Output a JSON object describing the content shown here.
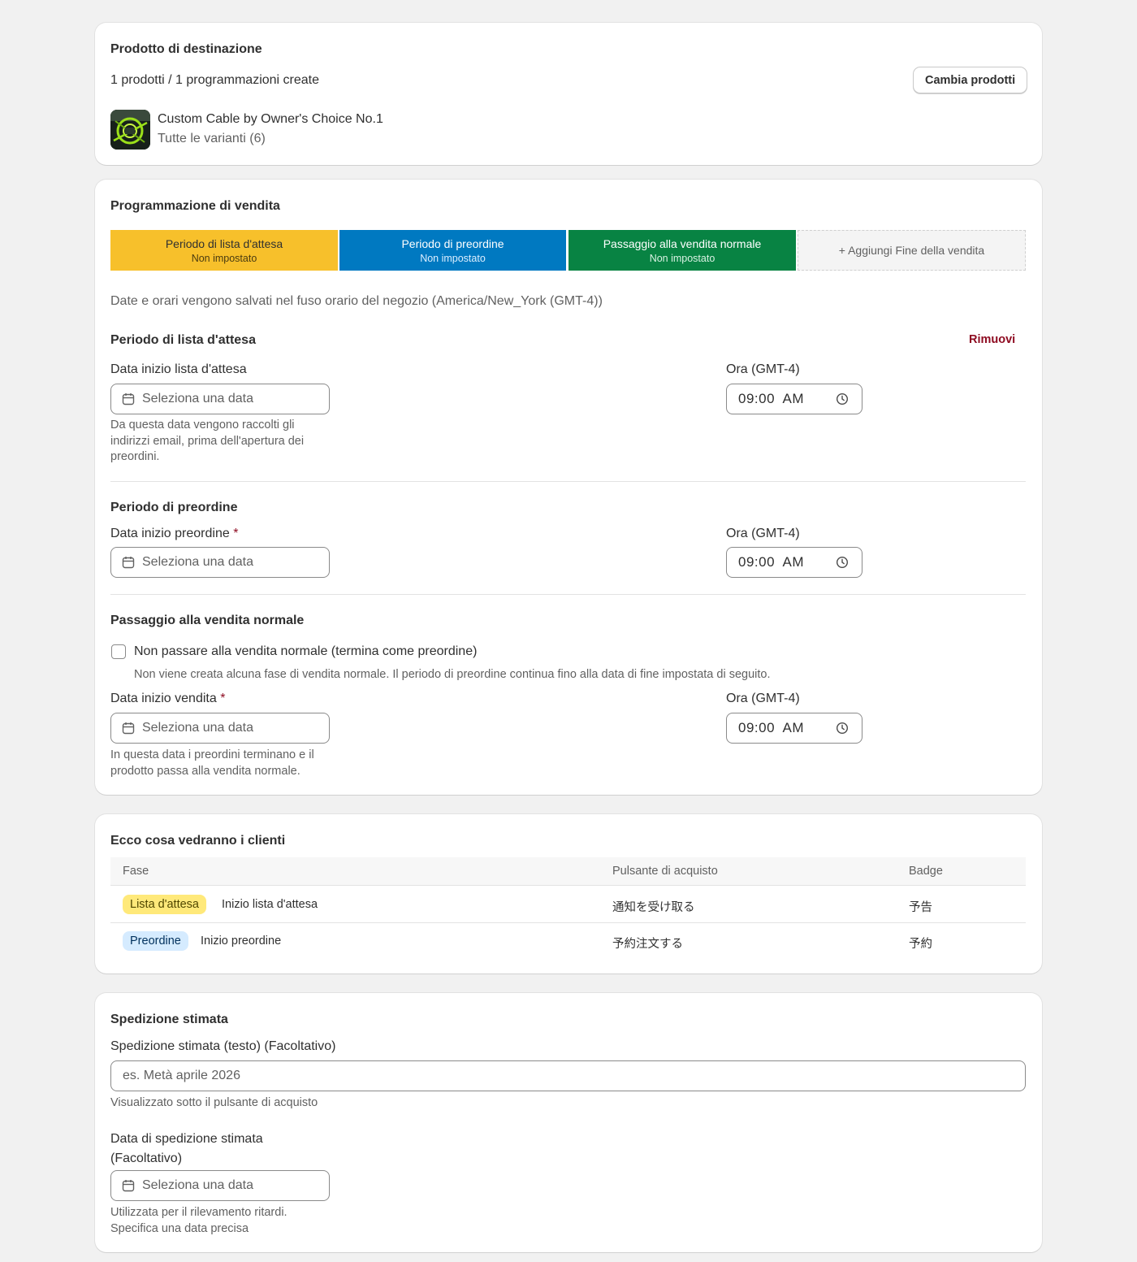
{
  "colors": {
    "waitlist": "#f7c02b",
    "preorder": "#0079c1",
    "normal_sale": "#088343",
    "danger": "#8e0b21",
    "badge_waitlist": "#ffe97a",
    "badge_preorder": "#d5ebff"
  },
  "target_product": {
    "title": "Prodotto di destinazione",
    "summary": "1 prodotti / 1 programmazioni create",
    "change_button": "Cambia prodotti",
    "product_name": "Custom Cable by Owner's Choice No.1",
    "product_variants": "Tutte le varianti (6)"
  },
  "schedule": {
    "title": "Programmazione di vendita",
    "phases": [
      {
        "label": "Periodo di lista d'attesa",
        "status": "Non impostato"
      },
      {
        "label": "Periodo di preordine",
        "status": "Non impostato"
      },
      {
        "label": "Passaggio alla vendita normale",
        "status": "Non impostato"
      }
    ],
    "add_end_label": "+ Aggiungi Fine della vendita",
    "timezone_note": "Date e orari vengono salvati nel fuso orario del negozio (America/New_York (GMT-4))",
    "waitlist": {
      "title": "Periodo di lista d'attesa",
      "remove_label": "Rimuovi",
      "date_label": "Data inizio lista d'attesa",
      "date_placeholder": "Seleziona una data",
      "help": "Da questa data vengono raccolti gli indirizzi email, prima dell'apertura dei preordini.",
      "time_label": "Ora (GMT-4)",
      "time_value": "09:00  AM"
    },
    "preorder": {
      "title": "Periodo di preordine",
      "date_label": "Data inizio preordine",
      "required_mark": "*",
      "date_placeholder": "Seleziona una data",
      "time_label": "Ora (GMT-4)",
      "time_value": "09:00  AM"
    },
    "normal_sale": {
      "title": "Passaggio alla vendita normale",
      "checkbox_label": "Non passare alla vendita normale (termina come preordine)",
      "checkbox_help": "Non viene creata alcuna fase di vendita normale. Il periodo di preordine continua fino alla data di fine impostata di seguito.",
      "date_label": "Data inizio vendita",
      "required_mark": "*",
      "date_placeholder": "Seleziona una data",
      "help": "In questa data i preordini terminano e il prodotto passa alla vendita normale.",
      "time_label": "Ora (GMT-4)",
      "time_value": "09:00  AM"
    }
  },
  "customer_view": {
    "title": "Ecco cosa vedranno i clienti",
    "columns": [
      "Fase",
      "Pulsante di acquisto",
      "Badge"
    ],
    "rows": [
      {
        "badge": "Lista d'attesa",
        "phase": "Inizio lista d'attesa",
        "button": "通知を受け取る",
        "badge_text": "予告"
      },
      {
        "badge": "Preordine",
        "phase": "Inizio preordine",
        "button": "予約注文する",
        "badge_text": "予約"
      }
    ]
  },
  "shipping": {
    "title": "Spedizione stimata",
    "text_label": "Spedizione stimata (testo) (Facoltativo)",
    "text_placeholder": "es. Metà aprile 2026",
    "text_help": "Visualizzato sotto il pulsante di acquisto",
    "date_label_line1": "Data di spedizione stimata",
    "date_label_line2": "(Facoltativo)",
    "date_placeholder": "Seleziona una data",
    "date_help_line1": "Utilizzata per il rilevamento ritardi.",
    "date_help_line2": "Specifica una data precisa"
  }
}
